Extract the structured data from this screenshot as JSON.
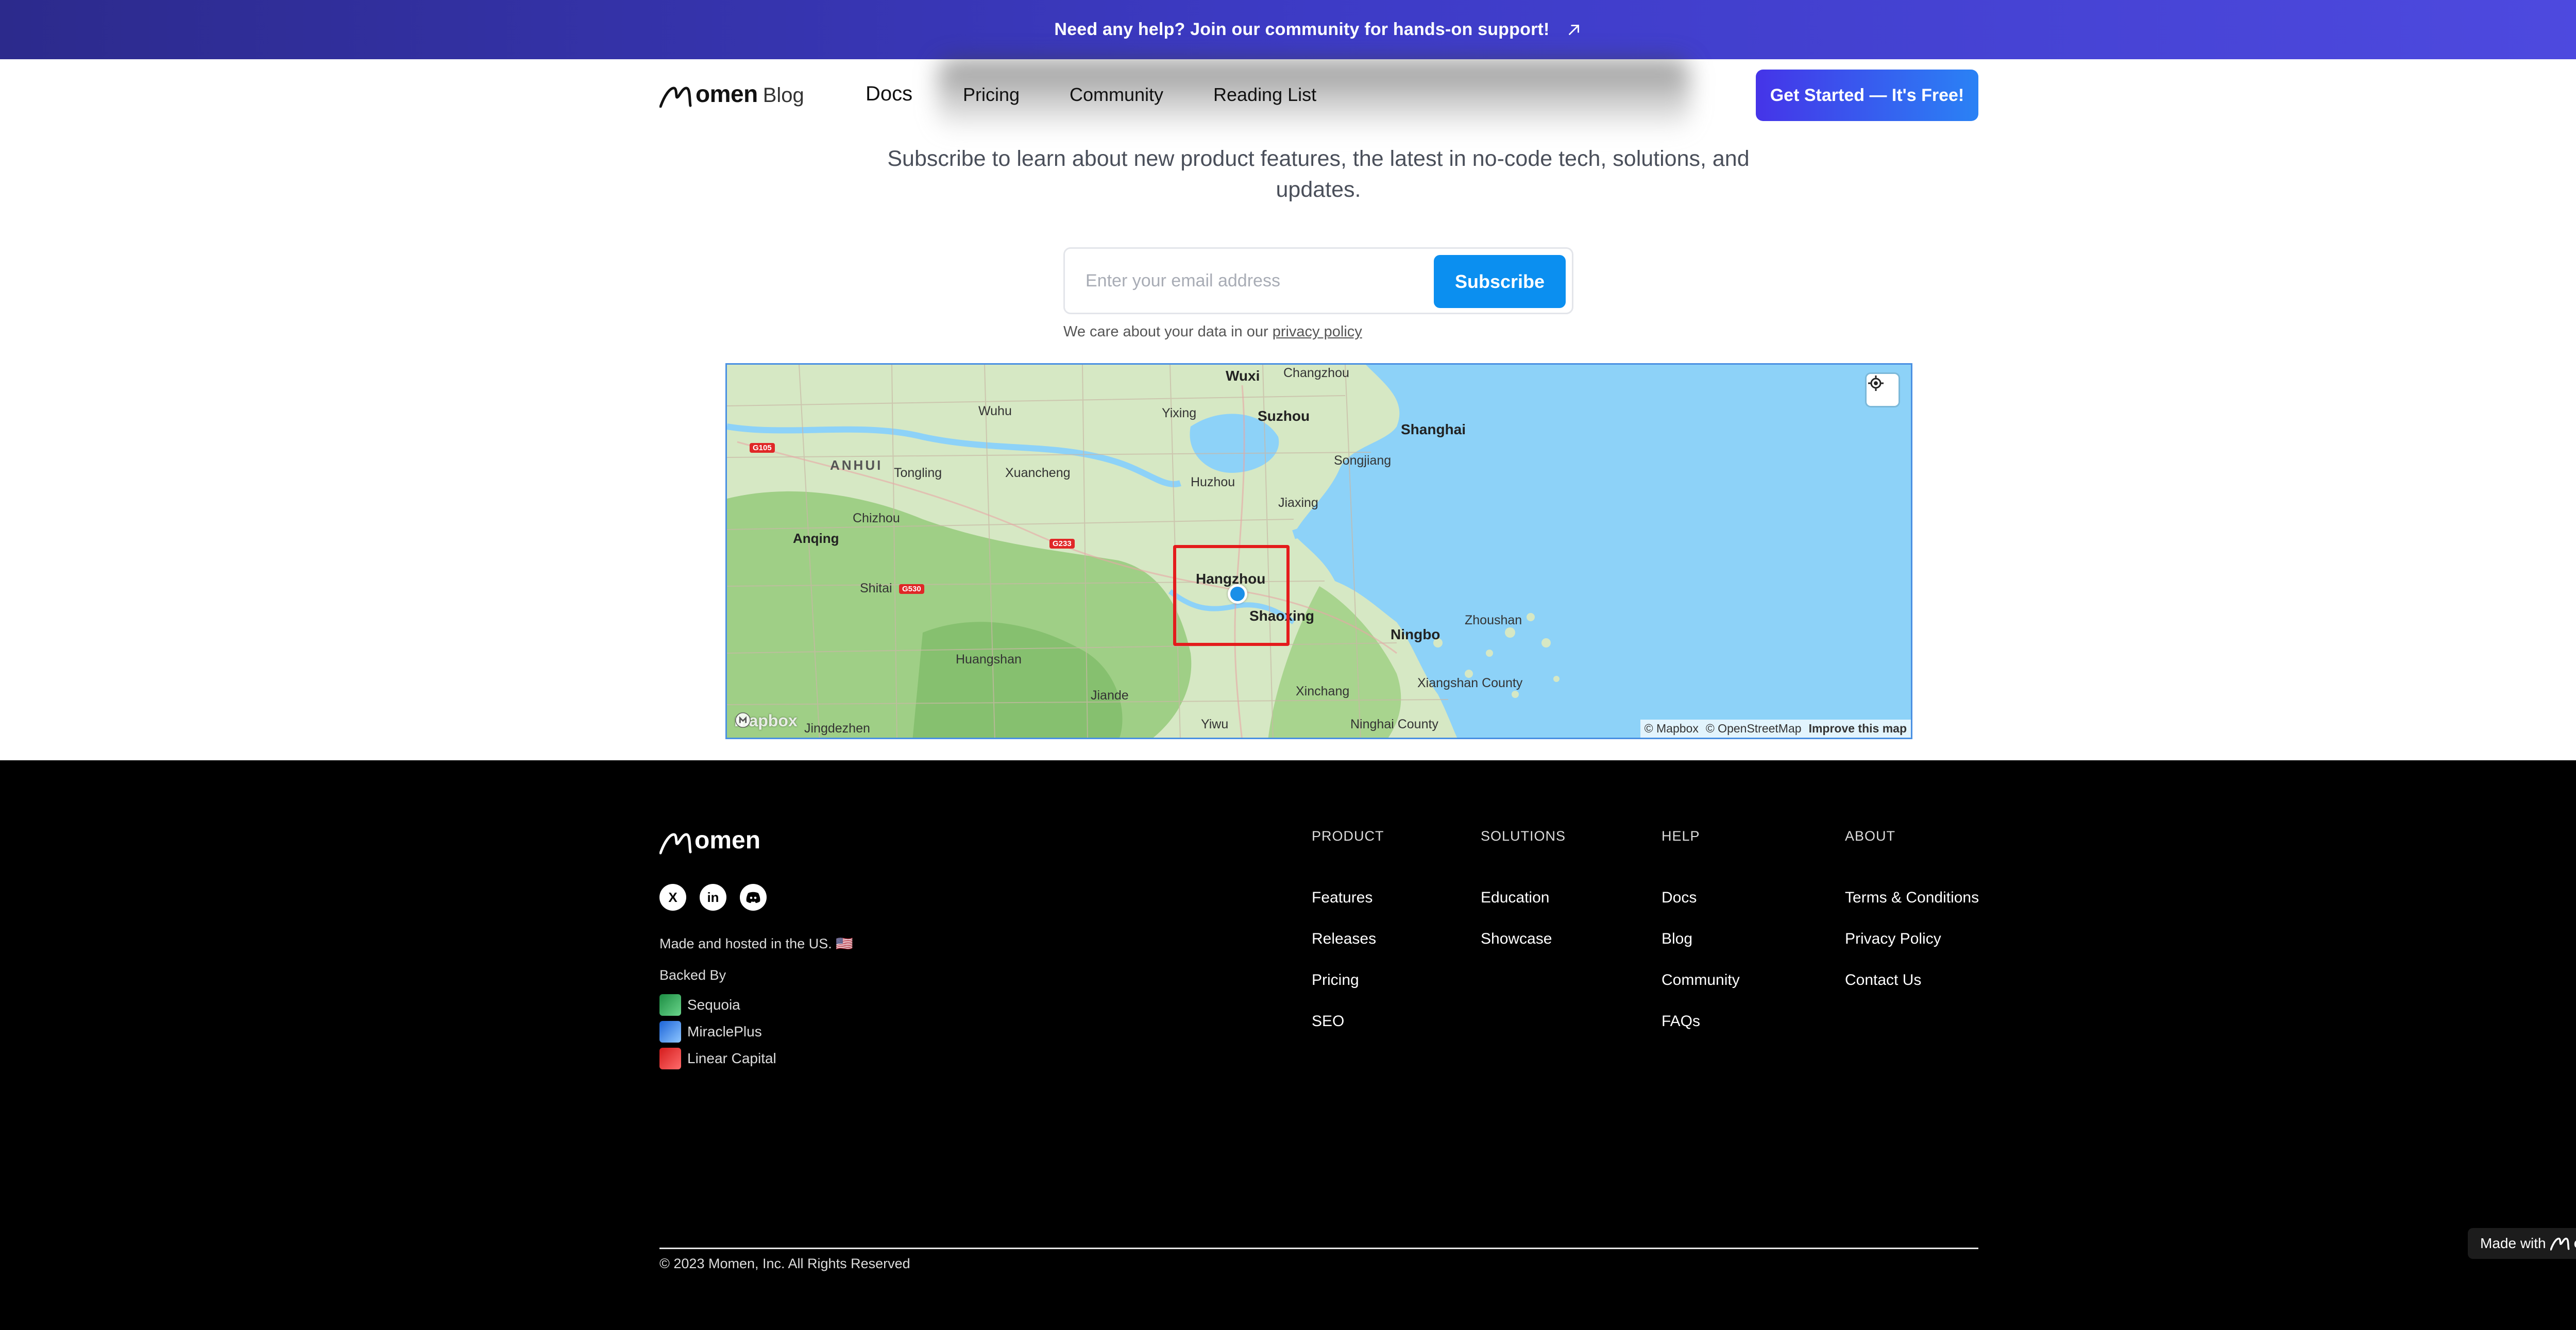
{
  "banner": {
    "text": "Need any help? Join our community for hands-on support!",
    "arrow_icon": "arrow-up-right-icon",
    "close_icon": "close-icon"
  },
  "nav": {
    "logo_word": "omen",
    "logo_blog": "Blog",
    "links": [
      "Docs",
      "Pricing",
      "Community",
      "Reading List"
    ],
    "cta": "Get Started — It's Free!"
  },
  "subscribe": {
    "description": "Subscribe to learn about new product features, the latest in no-code tech, solutions, and updates.",
    "placeholder": "Enter your email address",
    "button": "Subscribe",
    "note_prefix": "We care about your data in our ",
    "note_link": "privacy policy"
  },
  "map": {
    "labels_big": [
      "Shanghai",
      "Hangzhou",
      "Shaoxing",
      "Ningbo",
      "Suzhou",
      "Wuxi"
    ],
    "labels": [
      "Wuhu",
      "Yixing",
      "Songjiang",
      "Tongling",
      "Xuancheng",
      "Huzhou",
      "Jiaxing",
      "Chizhou",
      "Anqing",
      "Shitai",
      "Zhoushan",
      "Huangshan",
      "Jiande",
      "Xinchang",
      "Xiangshan County",
      "Ninghai County",
      "Yiwu",
      "Jingdezhen",
      "Changzhou"
    ],
    "region": "ANHUI",
    "shields": [
      "G105",
      "G233",
      "G530"
    ],
    "attribution": [
      "© Mapbox",
      "© OpenStreetMap",
      "Improve this map"
    ],
    "mapbox_brand": "mapbox",
    "locate_icon": "locate-icon",
    "marker_icon": "location-dot-icon",
    "accent_box_color": "#e41c1c"
  },
  "footer": {
    "logo_word": "omen",
    "social": [
      "X",
      "in",
      "discord"
    ],
    "hosted": "Made and hosted in the US. 🇺🇸",
    "backed_by": "Backed By",
    "backers": [
      "Sequoia",
      "MiraclePlus",
      "Linear Capital"
    ],
    "columns": [
      {
        "head": "PRODUCT",
        "links": [
          "Features",
          "Releases",
          "Pricing",
          "SEO"
        ]
      },
      {
        "head": "SOLUTIONS",
        "links": [
          "Education",
          "Showcase"
        ]
      },
      {
        "head": "HELP",
        "links": [
          "Docs",
          "Blog",
          "Community",
          "FAQs"
        ]
      },
      {
        "head": "ABOUT",
        "links": [
          "Terms & Conditions",
          "Privacy Policy",
          "Contact Us"
        ]
      }
    ],
    "copyright": "© 2023 Momen, Inc. All Rights Reserved",
    "made_with": "Made with",
    "made_with_brand": "omen"
  },
  "colors": {
    "banner_start": "#2c2a8c",
    "banner_end": "#4e4ae0",
    "cta_start": "#4534e8",
    "cta_end": "#2a82f5",
    "subscribe_button": "#0b8ff0",
    "water": "#8dd2f8"
  }
}
